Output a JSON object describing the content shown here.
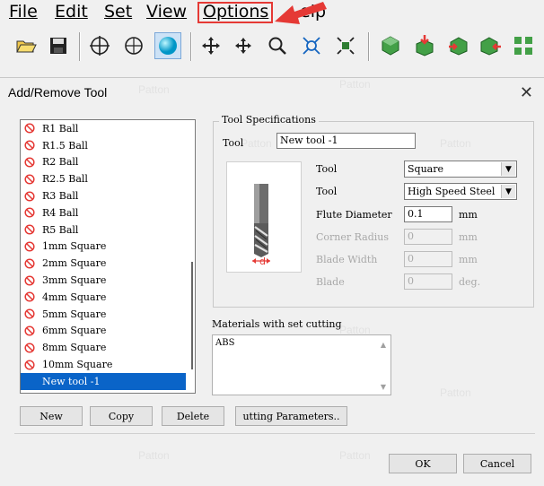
{
  "menu": {
    "items": [
      {
        "label": "File",
        "name": "menu-file"
      },
      {
        "label": "Edit",
        "name": "menu-edit"
      },
      {
        "label": "Set",
        "name": "menu-set"
      },
      {
        "label": "View",
        "name": "menu-view"
      },
      {
        "label": "Options",
        "name": "menu-options"
      },
      {
        "label": "elp",
        "name": "menu-help"
      }
    ]
  },
  "toolbar": {
    "icons": [
      "open-folder-icon",
      "save-icon",
      "crosshair-icon",
      "target-icon",
      "sphere-icon",
      "move-view-icon",
      "pan-icon",
      "zoom-icon",
      "fit-view-icon",
      "center-view-icon",
      "green-cube-icon",
      "cube-down-icon",
      "cube-right-icon",
      "cube-left-icon",
      "grid-cubes-icon"
    ]
  },
  "dialog": {
    "title": "Add/Remove Tool",
    "close": "✕",
    "tools": [
      "R1 Ball",
      "R1.5 Ball",
      "R2 Ball",
      "R2.5 Ball",
      "R3 Ball",
      "R4 Ball",
      "R5 Ball",
      "1mm Square",
      "2mm Square",
      "3mm Square",
      "4mm Square",
      "5mm Square",
      "6mm Square",
      "8mm Square",
      "10mm Square"
    ],
    "selected_tool": "New tool -1",
    "specs": {
      "legend": "Tool Specifications",
      "tool_label": "Tool",
      "tool_name": "New tool -1",
      "type_label": "Tool",
      "type_value": "Square",
      "material_label": "Tool",
      "material_value": "High Speed Steel",
      "flute_label": "Flute Diameter",
      "flute_value": "0.1",
      "flute_unit": "mm",
      "corner_label": "Corner Radius",
      "corner_value": "0",
      "corner_unit": "mm",
      "blade_width_label": "Blade Width",
      "blade_width_value": "0",
      "blade_width_unit": "mm",
      "blade_label": "Blade",
      "blade_value": "0",
      "blade_unit": "deg.",
      "diagram_label": "d"
    },
    "materials": {
      "label": "Materials with set cutting",
      "items": [
        "ABS"
      ]
    },
    "buttons": {
      "new": "New",
      "copy": "Copy",
      "delete": "Delete",
      "cutting": "utting Parameters..",
      "ok": "OK",
      "cancel": "Cancel"
    },
    "watermark": "Patton"
  }
}
